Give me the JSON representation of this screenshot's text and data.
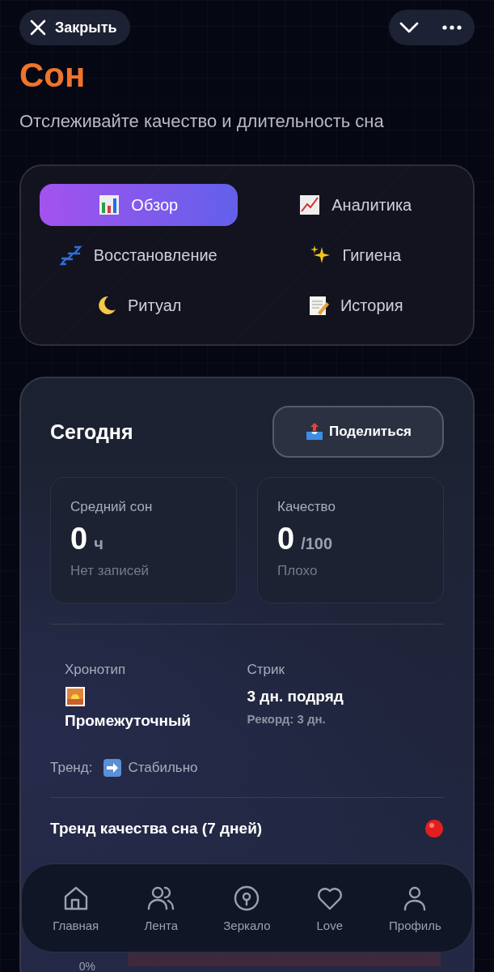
{
  "header": {
    "close_label": "Закрыть"
  },
  "title": "Сон",
  "subtitle": "Отслеживайте качество и длительность сна",
  "tabs": [
    {
      "label": "Обзор",
      "selected": true
    },
    {
      "label": "Аналитика",
      "selected": false
    },
    {
      "label": "Восстановление",
      "selected": false
    },
    {
      "label": "Гигиена",
      "selected": false
    },
    {
      "label": "Ритуал",
      "selected": false
    },
    {
      "label": "История",
      "selected": false
    }
  ],
  "today": {
    "title": "Сегодня",
    "share_label": "Поделиться",
    "stats": [
      {
        "label": "Средний сон",
        "value": "0",
        "unit": "ч",
        "note": "Нет записей"
      },
      {
        "label": "Качество",
        "value": "0",
        "unit": "/100",
        "note": "Плохо"
      }
    ],
    "chronotype": {
      "label": "Хронотип",
      "value": "Промежуточный"
    },
    "streak": {
      "label": "Стрик",
      "value": "3 дн. подряд",
      "record": "Рекорд: 3 дн."
    },
    "trend": {
      "label": "Тренд:",
      "value": "Стабильно"
    },
    "quality_chart": {
      "title": "Тренд качества сна (7 дней)",
      "y_labels": [
        "0%"
      ]
    }
  },
  "nav": [
    {
      "label": "Главная"
    },
    {
      "label": "Лента"
    },
    {
      "label": "Зеркало"
    },
    {
      "label": "Love"
    },
    {
      "label": "Профиль"
    }
  ]
}
